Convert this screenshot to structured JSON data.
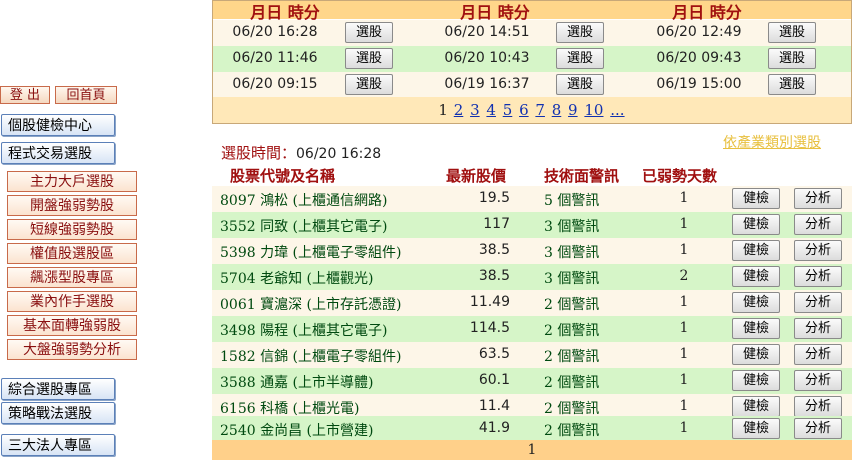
{
  "nav": {
    "logout": "登 出",
    "home": "回首頁",
    "main_items": [
      "個股健檢中心",
      "程式交易選股"
    ],
    "sub_items": [
      "主力大戶選股",
      "開盤強弱勢股",
      "短線強弱勢股",
      "權值股選股區",
      "飆漲型股專區",
      "業內作手選股",
      "基本面轉強弱股",
      "大盤強弱勢分析"
    ],
    "bottom_items": [
      "綜合選股專區",
      "策略戰法選股",
      "三大法人專區"
    ]
  },
  "time_table": {
    "header": [
      "月日 時分",
      "月日 時分",
      "月日 時分"
    ],
    "button_label": "選股",
    "rows": [
      [
        "06/20 16:28",
        "06/20 14:51",
        "06/20 12:49"
      ],
      [
        "06/20 11:46",
        "06/20 10:43",
        "06/20 09:43"
      ],
      [
        "06/20 09:15",
        "06/19 16:37",
        "06/19 15:00"
      ]
    ],
    "pager": {
      "current": "1",
      "pages": [
        "2",
        "3",
        "4",
        "5",
        "6",
        "7",
        "8",
        "9",
        "10",
        "..."
      ]
    },
    "colors": {
      "header": "#ffd68a",
      "row_a": "#fdf6e8",
      "row_b": "#d6f5c8",
      "pager": "#ffe8b8"
    }
  },
  "stock_panel": {
    "by_industry_link": "依產業類別選股",
    "pick_time_label": "選股時間：",
    "pick_time_value": "06/20 16:28",
    "headers": [
      "股票代號及名稱",
      "最新股價",
      "技術面警訊",
      "已弱勢天數"
    ],
    "check_label": "健檢",
    "analyze_label": "分析",
    "rows": [
      {
        "name": "8097 鴻松 (上櫃通信網路)",
        "price": "19.5",
        "signal": "5 個警訊",
        "days": "1"
      },
      {
        "name": "3552 同致 (上櫃其它電子)",
        "price": "117",
        "signal": "3 個警訊",
        "days": "1"
      },
      {
        "name": "5398 力瑋 (上櫃電子零組件)",
        "price": "38.5",
        "signal": "3 個警訊",
        "days": "1"
      },
      {
        "name": "5704 老爺知 (上櫃觀光)",
        "price": "38.5",
        "signal": "3 個警訊",
        "days": "2"
      },
      {
        "name": "0061 寶滬深 (上市存託憑證)",
        "price": "11.49",
        "signal": "2 個警訊",
        "days": "1"
      },
      {
        "name": "3498 陽程 (上櫃其它電子)",
        "price": "114.5",
        "signal": "2 個警訊",
        "days": "1"
      },
      {
        "name": "1582 信錦 (上櫃電子零組件)",
        "price": "63.5",
        "signal": "2 個警訊",
        "days": "1"
      },
      {
        "name": "3588 通嘉 (上市半導體)",
        "price": "60.1",
        "signal": "2 個警訊",
        "days": "1"
      },
      {
        "name": "6156 科橋 (上櫃光電)",
        "price": "11.4",
        "signal": "2 個警訊",
        "days": "1"
      },
      {
        "name": "2540 金尚昌 (上市營建)",
        "price": "41.9",
        "signal": "2 個警訊",
        "days": "1"
      }
    ],
    "footer_page": "1",
    "colors": {
      "row_a": "#fdf6e8",
      "row_b": "#d6f5c8",
      "header_text": "#a01010",
      "name_text": "#004a10"
    }
  }
}
